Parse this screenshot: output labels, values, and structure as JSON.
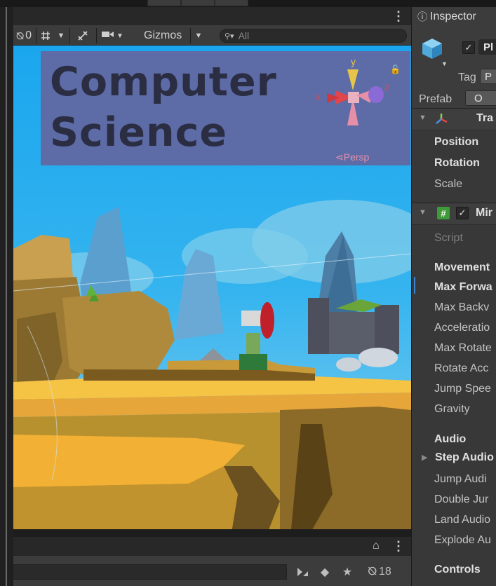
{
  "scene": {
    "toolbar": {
      "hidden_count": "0",
      "gizmos_label": "Gizmos",
      "search_placeholder": "All"
    },
    "overlay": {
      "title_line1": "Computer",
      "title_line2": "Science",
      "gizmo_axes": {
        "x": "x",
        "y": "y",
        "z": "z"
      },
      "persp_label": "Persp"
    },
    "footer": {
      "hidden_objects_count": "18"
    }
  },
  "inspector": {
    "tab_label": "Inspector",
    "object": {
      "name_partial": "Pl",
      "tag_label": "Tag",
      "tag_value_partial": "P",
      "prefab_label": "Prefab",
      "prefab_button_partial": "O"
    },
    "transform": {
      "header_partial": "Tra",
      "position_label": "Position",
      "rotation_label": "Rotation",
      "scale_label": "Scale"
    },
    "script_component": {
      "header_partial": "Mir",
      "script_label": "Script",
      "movement_header_partial": "Movement",
      "fields": [
        "Max Forwa",
        "Max Backv",
        "Acceleratio",
        "Max Rotate",
        "Rotate Acc",
        "Jump Spee",
        "Gravity"
      ],
      "audio_header": "Audio",
      "audio_fields": [
        "Step Audio",
        "Jump Audi",
        "Double Jur",
        "Land Audio",
        "Explode Au"
      ],
      "controls_header": "Controls"
    }
  },
  "colors": {
    "sky": "#1fa7ea",
    "title_panel": "#5d6ca7",
    "title_text": "#2b2d43",
    "ground_yellow": "#f2b134",
    "gizmo_x": "#e0474c",
    "gizmo_y": "#e8c54a",
    "gizmo_z": "#8a6bd6",
    "persp_text": "#e58fa8"
  }
}
